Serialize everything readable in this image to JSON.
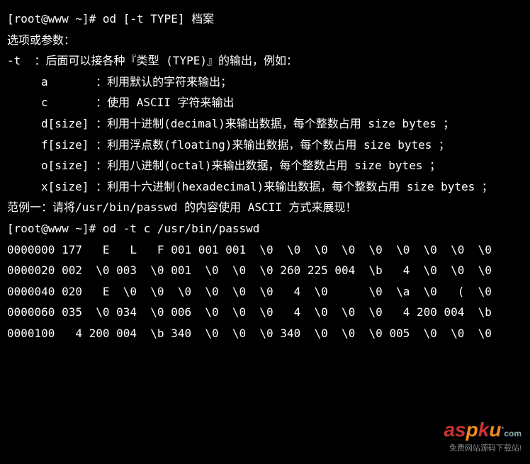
{
  "lines": {
    "l1": "[root@www ~]# od [-t TYPE] 档案",
    "l2": "选项或参数：",
    "l3": "-t  ：后面可以接各种『类型 (TYPE)』的输出，例如：",
    "l4": "a       ：利用默认的字符来输出；",
    "l5": "c       ：使用 ASCII 字符来输出",
    "l6": "d[size] ：利用十进制(decimal)来输出数据，每个整数占用 size bytes ；",
    "l7": "f[size] ：利用浮点数(floating)来输出数据，每个数占用 size bytes ；",
    "l8": "o[size] ：利用八进制(octal)来输出数据，每个整数占用 size bytes ；",
    "l9": "x[size] ：利用十六进制(hexadecimal)来输出数据，每个整数占用 size bytes ；",
    "l10": "",
    "l11": "范例一：请将/usr/bin/passwd 的内容使用 ASCII 方式来展现！",
    "l12": "[root@www ~]# od -t c /usr/bin/passwd",
    "l13": "0000000 177   E   L   F 001 001 001  \\0  \\0  \\0  \\0  \\0  \\0  \\0  \\0  \\0",
    "l14": "0000020 002  \\0 003  \\0 001  \\0  \\0  \\0 260 225 004  \\b   4  \\0  \\0  \\0",
    "l15": "0000040 020   E  \\0  \\0  \\0  \\0  \\0  \\0   4  \\0      \\0  \\a  \\0   (  \\0",
    "l16": "0000060 035  \\0 034  \\0 006  \\0  \\0  \\0   4  \\0  \\0  \\0   4 200 004  \\b",
    "l17": "0000100   4 200 004  \\b 340  \\0  \\0  \\0 340  \\0  \\0  \\0 005  \\0  \\0  \\0"
  },
  "watermark": {
    "brand_a": "a",
    "brand_s": "s",
    "brand_p": "p",
    "brand_k": "k",
    "brand_u": "u",
    "dot": ".",
    "com": "com",
    "sub": "免费网站源码下载站!"
  }
}
